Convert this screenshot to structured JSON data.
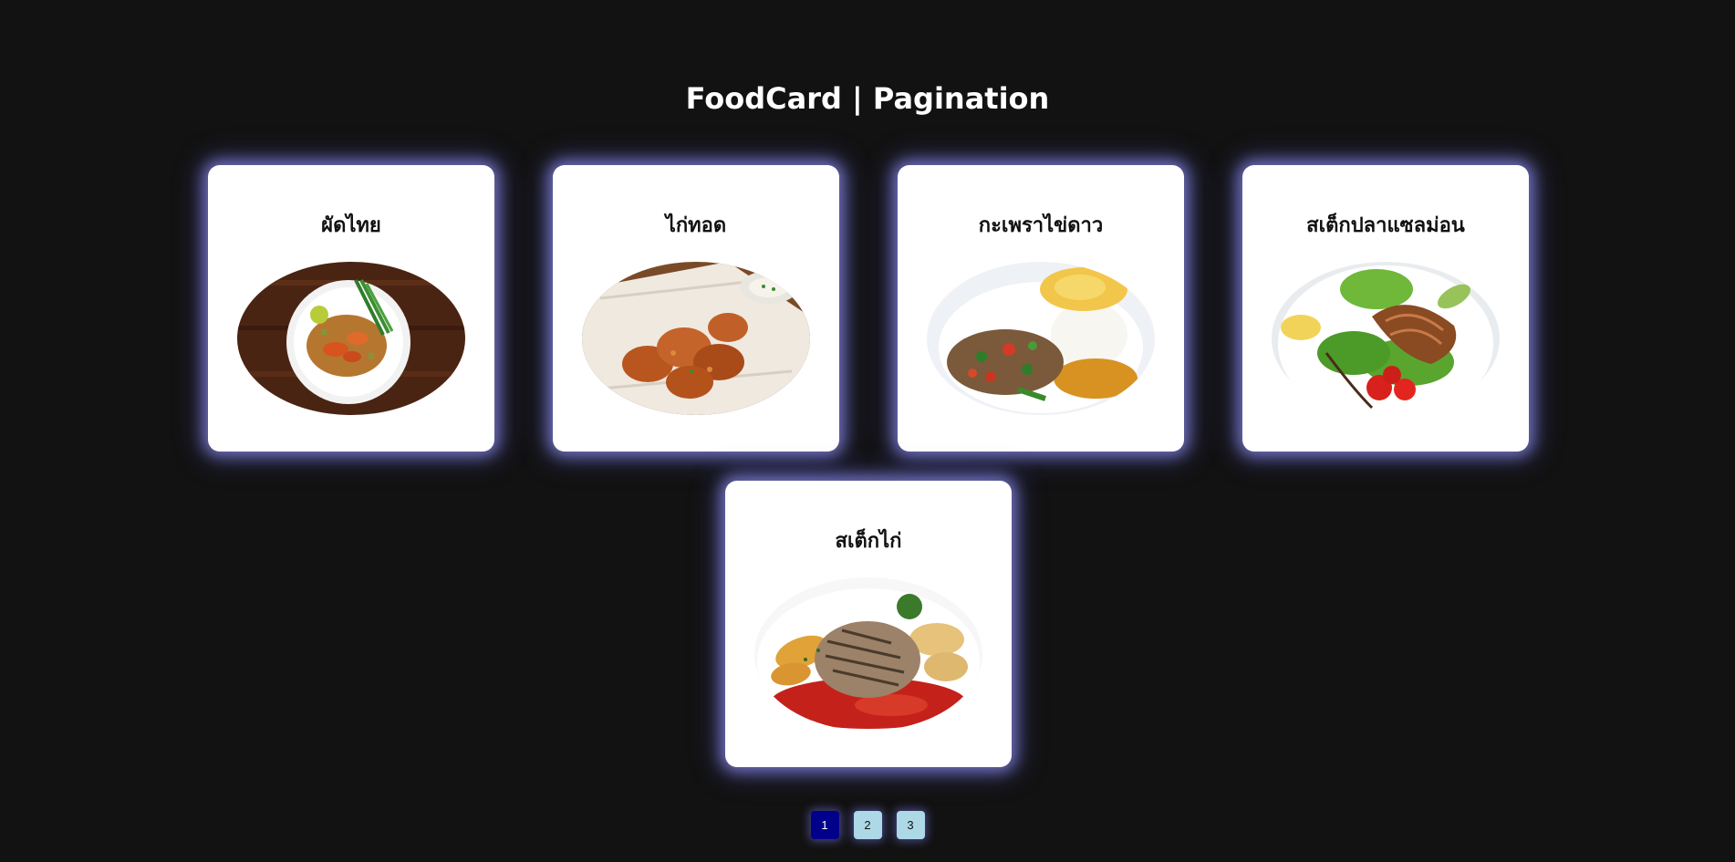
{
  "header": {
    "title": "FoodCard | Pagination"
  },
  "cards": [
    {
      "title": "ผัดไทย",
      "image_icon": "pad-thai-image"
    },
    {
      "title": "ไก่ทอด",
      "image_icon": "fried-chicken-image"
    },
    {
      "title": "กะเพราไข่ดาว",
      "image_icon": "basil-fried-egg-image"
    },
    {
      "title": "สเต็กปลาแซลม่อน",
      "image_icon": "salmon-steak-image"
    },
    {
      "title": "สเต็กไก่",
      "image_icon": "chicken-steak-image"
    }
  ],
  "pagination": {
    "pages": [
      "1",
      "2",
      "3"
    ],
    "current": "1"
  },
  "colors": {
    "background": "#121212",
    "card": "#ffffff",
    "glow": "#8c8ceb",
    "active_page": "#00008b",
    "inactive_page": "#add8e6"
  }
}
